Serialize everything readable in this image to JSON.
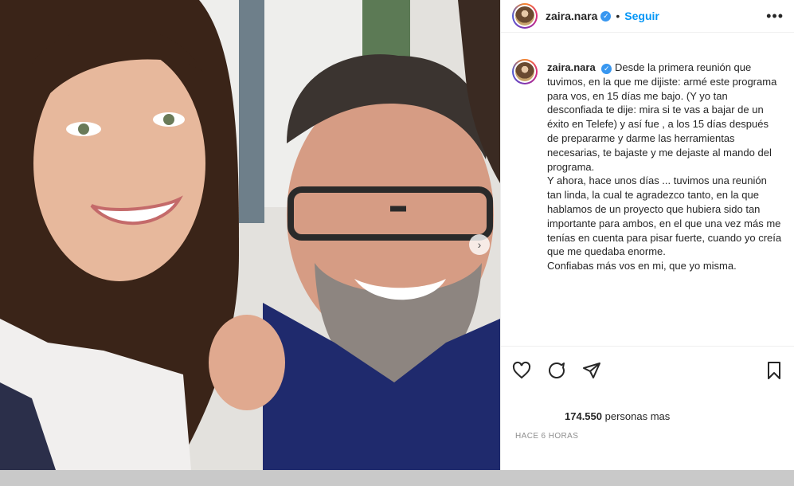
{
  "post": {
    "username": "zaira.nara",
    "follow_label": "Seguir",
    "more_label": "•••",
    "separator": "•",
    "verified_mark": "✓"
  },
  "caption": {
    "username": "zaira.nara",
    "text": "Desde la primera reunión que tuvimos, en la que me dijiste: armé este programa para vos, en 15 días me bajo. (Y yo tan desconfiada te dije: mira si te vas a bajar de un éxito en Telefe) y así fue , a los 15 días después de prepararme y darme las herramientas necesarias, te bajaste y me dejaste al mando del programa.\nY ahora, hace unos días ... tuvimos una reunión tan linda, la cual te agradezco tanto, en la que hablamos de un proyecto que hubiera sido tan importante para ambos, en el que una vez más me tenías en cuenta para pisar fuerte, cuando yo creía que me quedaba enorme.\nConfiabas más vos en mi, que yo misma."
  },
  "likes": {
    "count": "174.550",
    "suffix": "personas mas"
  },
  "timestamp": "HACE 6 HORAS",
  "icons": {
    "like": "heart-icon",
    "comment": "comment-icon",
    "share": "share-icon",
    "save": "bookmark-icon",
    "next": "chevron-right-icon"
  },
  "colors": {
    "link": "#0095f6",
    "verified": "#3897f0",
    "text": "#262626",
    "muted": "#8e8e8e"
  }
}
